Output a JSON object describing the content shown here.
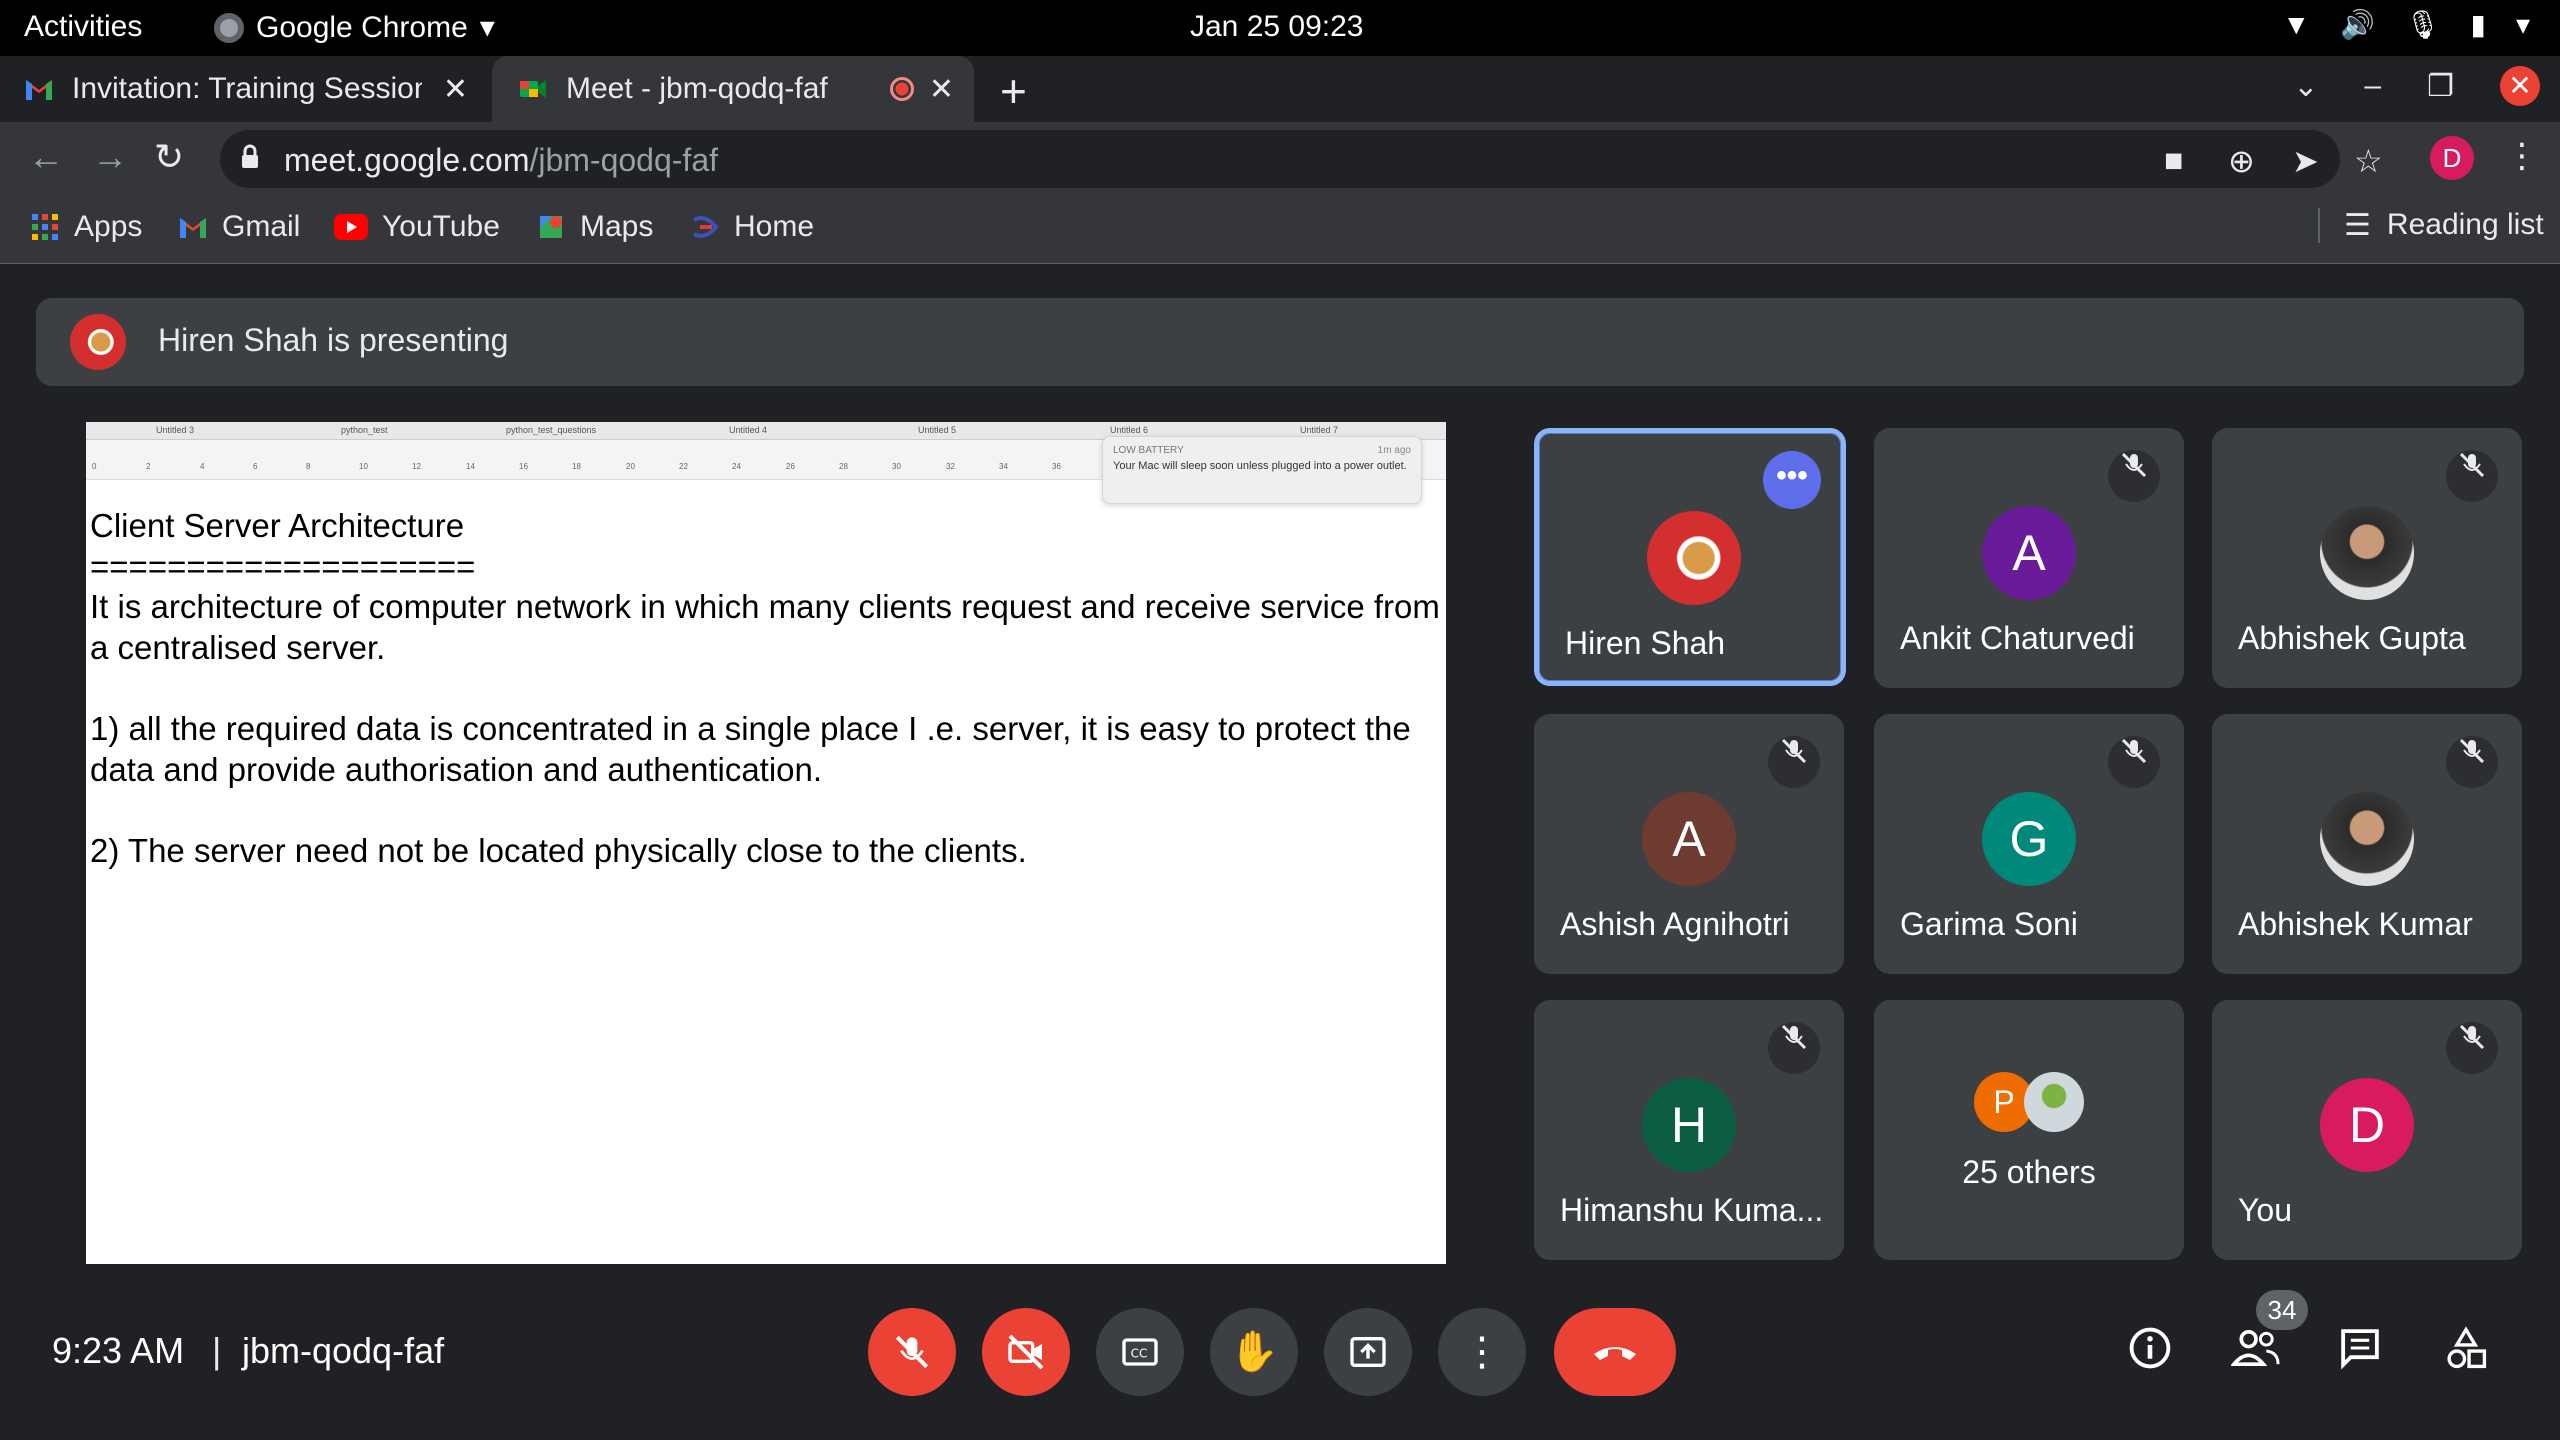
{
  "system": {
    "activities": "Activities",
    "app_name": "Google Chrome",
    "date_time": "Jan 25  09:23",
    "tray_icons": [
      "wifi-icon",
      "volume-icon",
      "mic-icon",
      "battery-icon",
      "system-menu-chevron-icon"
    ]
  },
  "tabs": [
    {
      "title": "Invitation: Training Session",
      "favicon": "gmail-icon"
    },
    {
      "title": "Meet - jbm-qodq-faf",
      "favicon": "meet-icon",
      "recording": true
    }
  ],
  "omnibox": {
    "host": "meet.google.com",
    "path": "/jbm-qodq-faf"
  },
  "profile_initial": "D",
  "bookmarks": [
    {
      "label": "Apps",
      "icon": "apps-grid-icon"
    },
    {
      "label": "Gmail",
      "icon": "gmail-icon"
    },
    {
      "label": "YouTube",
      "icon": "youtube-icon"
    },
    {
      "label": "Maps",
      "icon": "maps-icon"
    },
    {
      "label": "Home",
      "icon": "home-icon"
    }
  ],
  "reading_list": "Reading list",
  "presenting": {
    "text": "Hiren Shah is presenting"
  },
  "screen": {
    "doc_tabs": [
      "Untitled 3",
      "python_test",
      "python_test_questions",
      "Untitled 4",
      "Untitled 5",
      "Untitled 6",
      "Untitled 7"
    ],
    "ruler_ticks": [
      "0",
      "2",
      "4",
      "6",
      "8",
      "10",
      "12",
      "14",
      "16",
      "18",
      "20",
      "22",
      "24",
      "26",
      "28",
      "30",
      "32",
      "34",
      "36"
    ],
    "notification": {
      "title": "LOW BATTERY",
      "time": "1m ago",
      "body": "Your Mac will sleep soon unless plugged into a power outlet."
    },
    "lines": [
      "Client Server Architecture",
      "====================",
      "It is architecture of computer network in which many clients request and receive service from a centralised server.",
      "",
      "1) all the required data is concentrated in a single place I .e. server, it is easy to protect the data and provide authorisation and authentication.",
      "",
      "2) The server need not be located physically close to the clients."
    ]
  },
  "participants": [
    {
      "name": "Hiren Shah",
      "initial": "",
      "color": "#d32f2f",
      "active": true
    },
    {
      "name": "Ankit Chaturvedi",
      "initial": "A",
      "color": "#6a1b9a"
    },
    {
      "name": "Abhishek Gupta",
      "initial": "",
      "color": "#3b3b3b"
    },
    {
      "name": "Ashish Agnihotri",
      "initial": "A",
      "color": "#6d3b2f"
    },
    {
      "name": "Garima Soni",
      "initial": "G",
      "color": "#00897b"
    },
    {
      "name": "Abhishek Kumar",
      "initial": "",
      "color": "#3b3b3b"
    },
    {
      "name": "Himanshu Kuma...",
      "initial": "H",
      "color": "#0b5e42"
    },
    {
      "name": "25 others",
      "initial": "P",
      "color": "#ef6c00"
    },
    {
      "name": "You",
      "initial": "D",
      "color": "#d81b60"
    }
  ],
  "bottom": {
    "time": "9:23 AM",
    "separator": "|",
    "meeting_code": "jbm-qodq-faf",
    "people_count": "34"
  }
}
